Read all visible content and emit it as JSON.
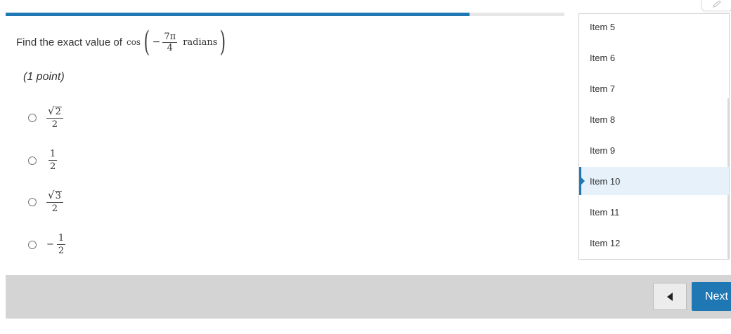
{
  "progress": {
    "fraction": 0.83
  },
  "question": {
    "prefix": "Find the exact value of",
    "fn": "cos",
    "sign": "−",
    "numerator": "7π",
    "denominator": "4",
    "unit": "radians",
    "points": "(1 point)"
  },
  "choices": [
    {
      "type": "sqrt",
      "radicand": "2",
      "denominator": "2"
    },
    {
      "type": "frac",
      "numerator": "1",
      "denominator": "2"
    },
    {
      "type": "sqrt",
      "radicand": "3",
      "denominator": "2"
    },
    {
      "type": "negfrac",
      "sign": "−",
      "numerator": "1",
      "denominator": "2"
    }
  ],
  "sidebar": {
    "items": [
      {
        "label": "Item 5"
      },
      {
        "label": "Item 6"
      },
      {
        "label": "Item 7"
      },
      {
        "label": "Item 8"
      },
      {
        "label": "Item 9"
      },
      {
        "label": "Item 10",
        "active": true
      },
      {
        "label": "Item 11"
      },
      {
        "label": "Item 12"
      }
    ]
  },
  "footer": {
    "next_label": "Next"
  },
  "icons": {
    "prev": "caret-left-icon",
    "corner": "pencil-icon"
  },
  "colors": {
    "accent": "#1f78b4",
    "footer": "#d4d4d4",
    "active_item_bg": "#e6f1fa"
  }
}
